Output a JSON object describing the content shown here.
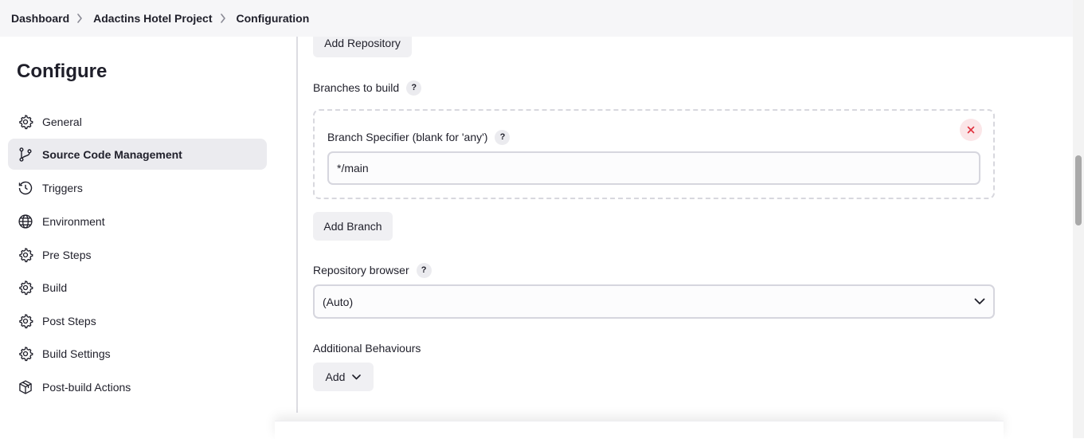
{
  "breadcrumb": [
    "Dashboard",
    "Adactins Hotel Project",
    "Configuration"
  ],
  "sidebar": {
    "title": "Configure",
    "items": [
      {
        "label": "General",
        "icon": "gear-icon"
      },
      {
        "label": "Source Code Management",
        "icon": "branch-icon",
        "active": true
      },
      {
        "label": "Triggers",
        "icon": "clock-icon"
      },
      {
        "label": "Environment",
        "icon": "globe-icon"
      },
      {
        "label": "Pre Steps",
        "icon": "gear-icon"
      },
      {
        "label": "Build",
        "icon": "gear-icon"
      },
      {
        "label": "Post Steps",
        "icon": "gear-icon"
      },
      {
        "label": "Build Settings",
        "icon": "gear-icon"
      },
      {
        "label": "Post-build Actions",
        "icon": "package-icon"
      }
    ]
  },
  "scm": {
    "add_repository": "Add Repository",
    "branches_label": "Branches to build",
    "help": "?",
    "branch_specifier_label": "Branch Specifier (blank for 'any')",
    "branch_specifier_value": "*/main",
    "add_branch": "Add Branch",
    "repo_browser_label": "Repository browser",
    "repo_browser_value": "(Auto)",
    "additional_behaviours_label": "Additional Behaviours",
    "add_label": "Add"
  },
  "colors": {
    "accent_active_bg": "#ebebef",
    "close_red": "#e0323f"
  }
}
